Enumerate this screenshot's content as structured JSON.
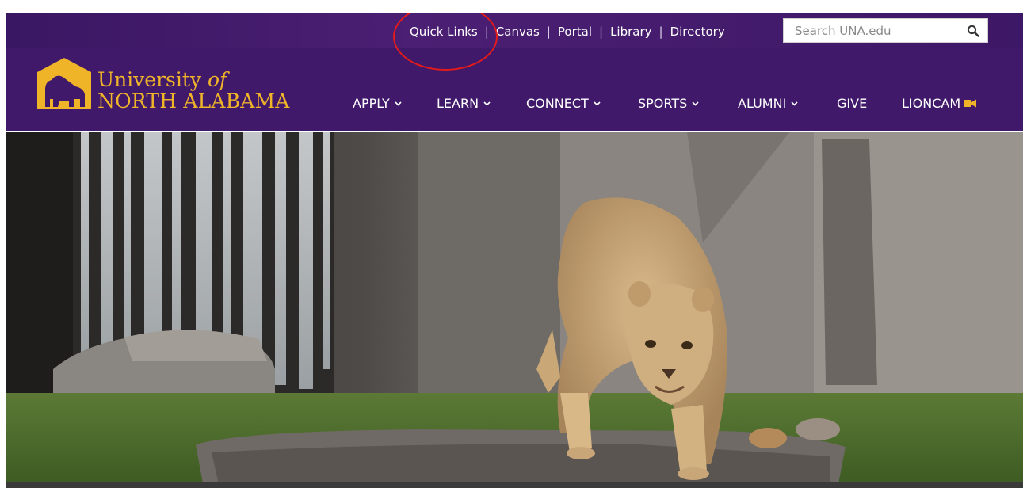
{
  "utility": {
    "links": [
      "Quick Links",
      "Canvas",
      "Portal",
      "Library",
      "Directory"
    ],
    "separator": "|",
    "search_placeholder": "Search UNA.edu"
  },
  "logo": {
    "line1_prefix": "University ",
    "line1_italic": "of",
    "line2": "NORTH ALABAMA"
  },
  "nav": [
    {
      "label": "APPLY"
    },
    {
      "label": "LEARN"
    },
    {
      "label": "CONNECT"
    },
    {
      "label": "SPORTS"
    },
    {
      "label": "ALUMNI"
    },
    {
      "label": "GIVE"
    },
    {
      "label": "LIONCAM"
    }
  ],
  "colors": {
    "brand_purple": "#40196b",
    "brand_gold": "#f0b429",
    "annotation_red": "#e21a1a"
  },
  "icons": {
    "search": "search-icon",
    "chevron": "chevron-down-icon",
    "video": "video-camera-icon",
    "logo_mark": "lion-logo-icon"
  }
}
